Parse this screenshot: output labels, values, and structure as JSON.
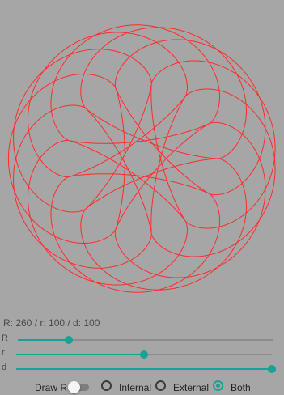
{
  "params": {
    "text": "R: 260 / r: 100 / d: 100"
  },
  "sliders": [
    {
      "label": "R",
      "value": 0.2
    },
    {
      "label": "r",
      "value": 0.5
    },
    {
      "label": "d",
      "value": 1.0
    }
  ],
  "controls": {
    "draw_r_label": "Draw R",
    "draw_r_on": false,
    "modes": [
      "Internal",
      "External",
      "Both"
    ],
    "selected_mode": "Both"
  },
  "colors": {
    "curve": "#ff2a2a",
    "accent": "#16a394",
    "background": "#a6a6a6"
  }
}
